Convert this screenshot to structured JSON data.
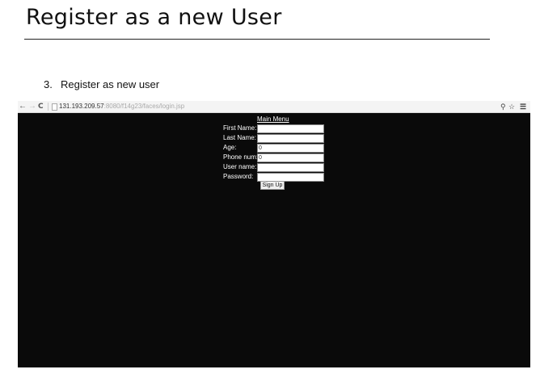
{
  "doc": {
    "title": "Register as a new User",
    "step_number": "3.",
    "step_text": "Register as new user"
  },
  "browser": {
    "url_host": "131.193.209.57",
    "url_path": ":8080/f14g23/faces/login.jsp",
    "icons": [
      "back-arrow-icon",
      "forward-arrow-icon",
      "reload-icon",
      "page-icon",
      "pin-icon",
      "star-icon",
      "menu-icon"
    ]
  },
  "form": {
    "main_menu_link": "Main Menu",
    "fields": [
      {
        "label": "First Name:",
        "value": ""
      },
      {
        "label": "Last Name:",
        "value": ""
      },
      {
        "label": "Age:",
        "value": "0"
      },
      {
        "label": "Phone num:",
        "value": "0"
      },
      {
        "label": "User name:",
        "value": ""
      },
      {
        "label": "Password:",
        "value": ""
      }
    ],
    "signup_label": "Sign Up"
  },
  "colors": {
    "page_background": "#0a0a0a",
    "text_on_dark": "#ffffff",
    "toolbar": "#f4f4f4"
  }
}
